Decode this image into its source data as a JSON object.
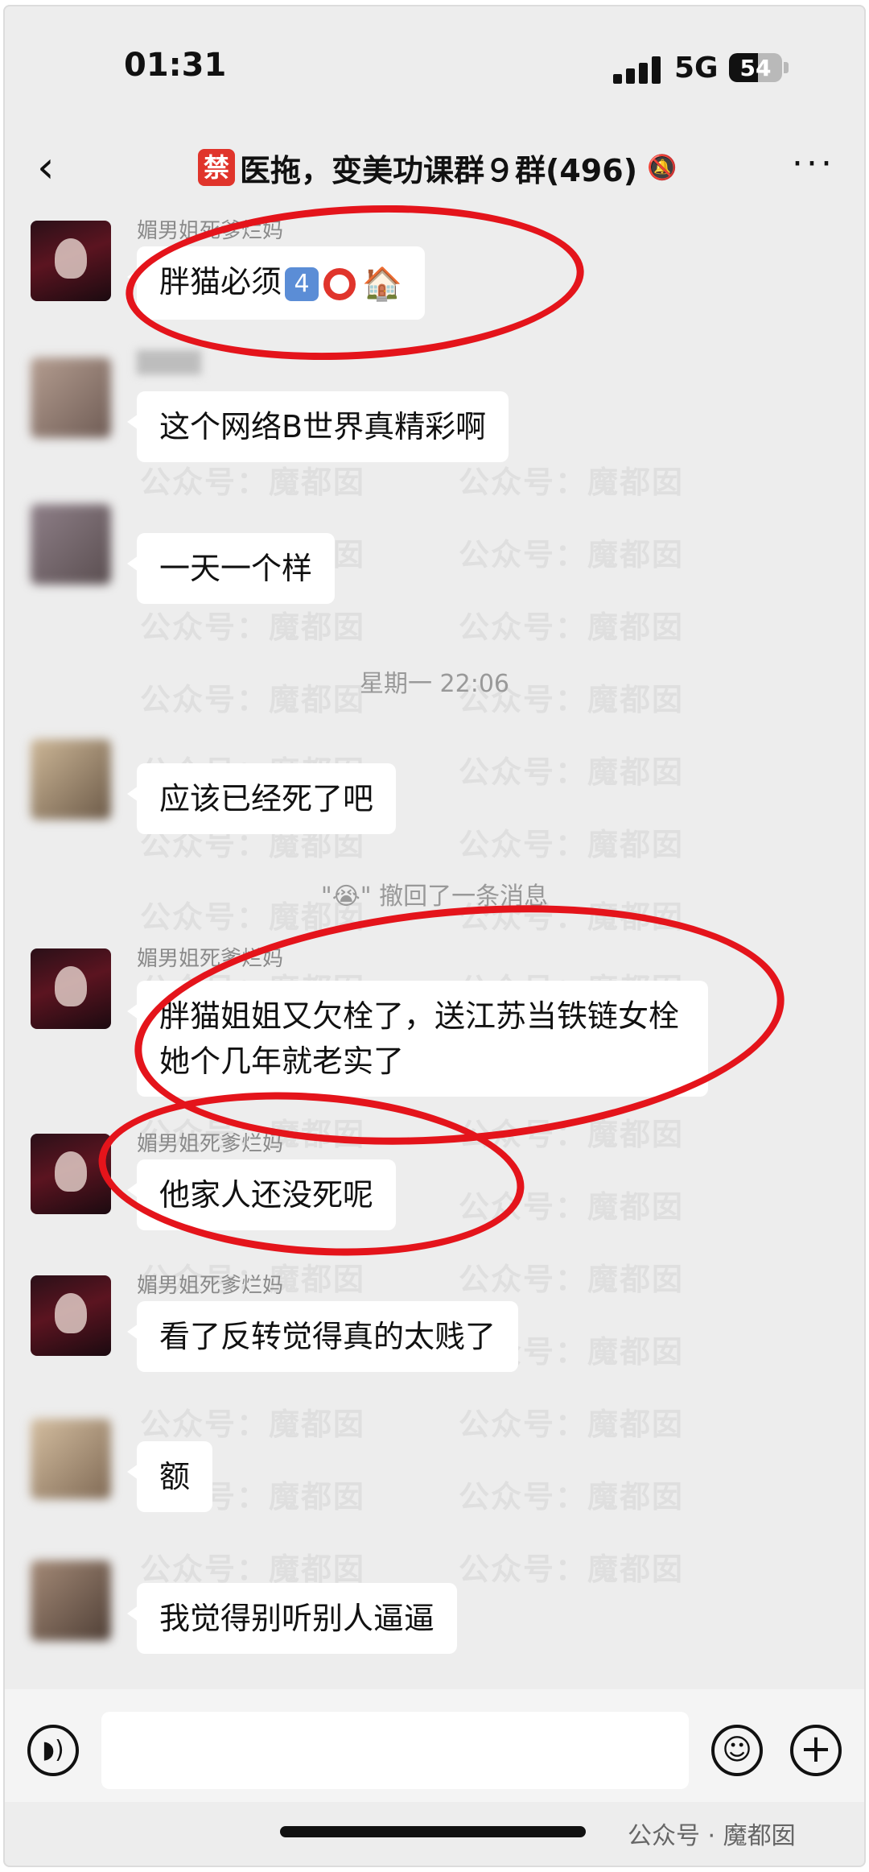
{
  "status_bar": {
    "time": "01:31",
    "network": "5G",
    "battery": "54",
    "battery_level": 0.54
  },
  "nav": {
    "back_icon": "chevron-left",
    "ban_badge": "禁",
    "title": "医拖，变美功课群９群(496)",
    "mute_icon": "bell-slash",
    "more_icon": "ellipsis"
  },
  "messages": {
    "m1": {
      "nickname": "媚男姐死爹烂妈",
      "text": "胖猫必须"
    },
    "m1_keycap": "4",
    "m2": {
      "text": "这个网络B世界真精彩啊"
    },
    "m3": {
      "text": "一天一个样"
    },
    "time_divider": "星期一 22:06",
    "m4": {
      "text": "应该已经死了吧"
    },
    "recall": {
      "quote_open": "\"",
      "emoji": "😭",
      "quote_close": "\"",
      "text": " 撤回了一条消息"
    },
    "m5": {
      "nickname": "媚男姐死爹烂妈",
      "text": "胖猫姐姐又欠栓了，送江苏当铁链女栓她个几年就老实了"
    },
    "m6": {
      "nickname": "媚男姐死爹烂妈",
      "text": "他家人还没死呢"
    },
    "m7": {
      "nickname": "媚男姐死爹烂妈",
      "text": "看了反转觉得真的太贱了"
    },
    "m8": {
      "text": "额"
    },
    "m9": {
      "text": "我觉得别听别人逼逼"
    }
  },
  "watermark": "公众号：魔都囡",
  "footer": "公众号 · 魔都囡",
  "colors": {
    "background": "#ededed",
    "bubble": "#ffffff",
    "annotation_red": "#e4141b",
    "ban_badge": "#e0342b"
  }
}
